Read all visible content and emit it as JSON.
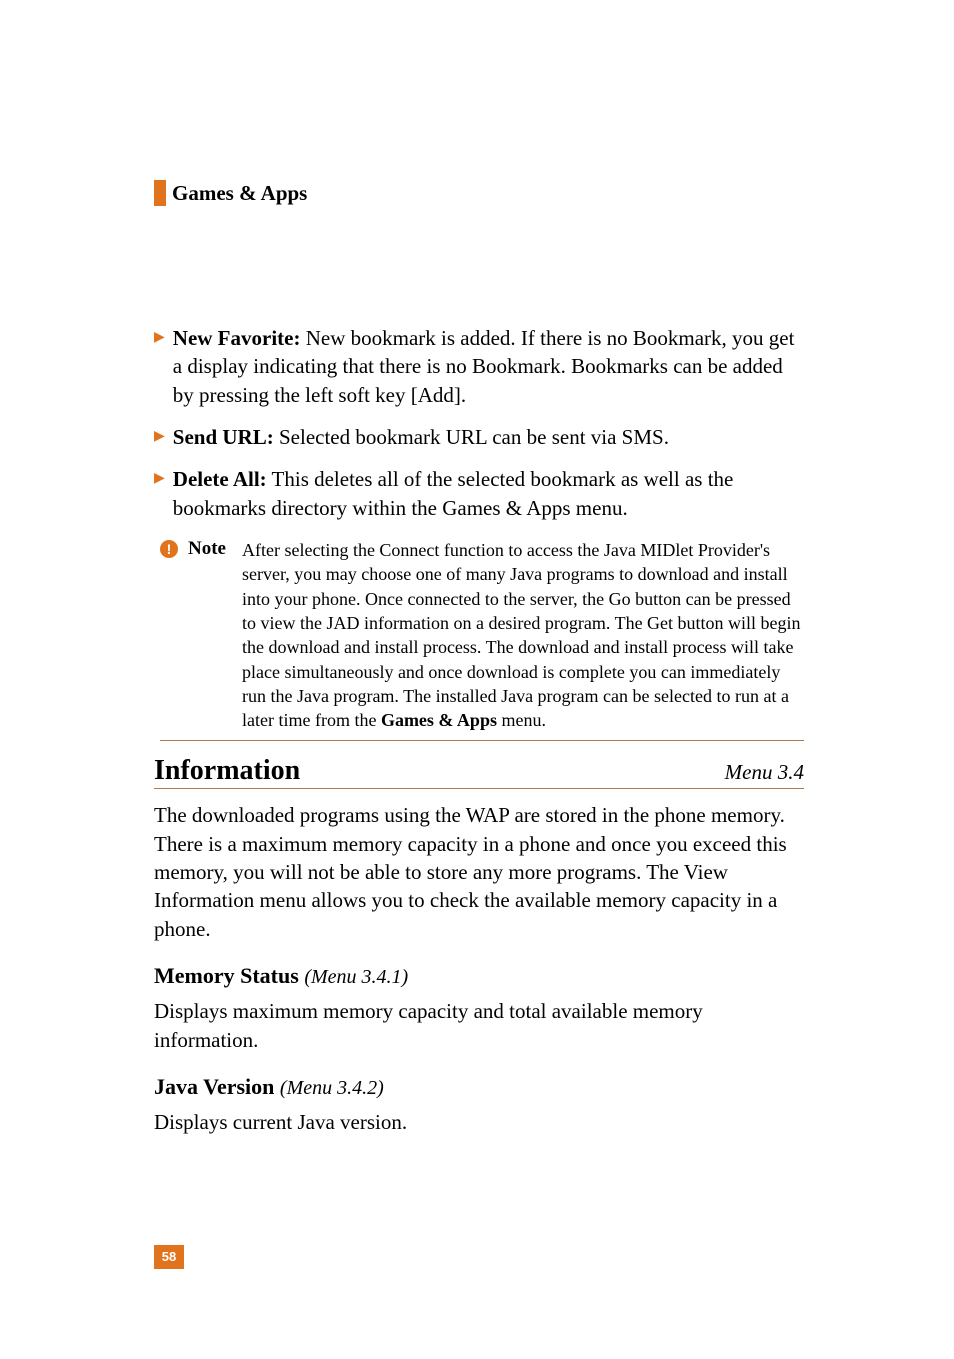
{
  "header": {
    "title": "Games & Apps"
  },
  "bullets": {
    "b1": {
      "label": "New Favorite:",
      "text": " New bookmark is added. If there is no Bookmark, you get a display indicating that there is no Bookmark. Bookmarks can be added by pressing the left soft key [Add]."
    },
    "b2": {
      "label": "Send URL:",
      "text": " Selected bookmark URL can be sent via SMS."
    },
    "b3": {
      "label": "Delete All:",
      "text": " This deletes all of the selected bookmark as well as the bookmarks directory within the Games & Apps menu."
    }
  },
  "note": {
    "icon": "!",
    "label": "Note",
    "body_pre": "After selecting the Connect function to access the Java MIDlet Provider's server, you may choose one of many Java programs to download and install into your phone. Once connected to the server, the Go button can be pressed to view the JAD information on a desired program. The Get button will begin the download and install process. The download and install process will take place simultaneously and once download is complete you can immediately run the Java program. The installed Java program can be selected to run at a later time from the ",
    "body_bold": "Games & Apps",
    "body_post": " menu."
  },
  "section": {
    "title": "Information",
    "menu": "Menu 3.4",
    "para": "The downloaded programs using the WAP are stored in the phone memory. There is a maximum memory capacity in a phone and once you exceed this memory, you will not be able to store any more programs. The View Information menu allows you to check the available memory capacity in a phone."
  },
  "sub1": {
    "title": "Memory Status ",
    "menu": "(Menu 3.4.1)",
    "para": "Displays maximum memory capacity and total available memory information."
  },
  "sub2": {
    "title": "Java Version ",
    "menu": "(Menu 3.4.2)",
    "para": "Displays current Java version."
  },
  "pagenum": "58"
}
